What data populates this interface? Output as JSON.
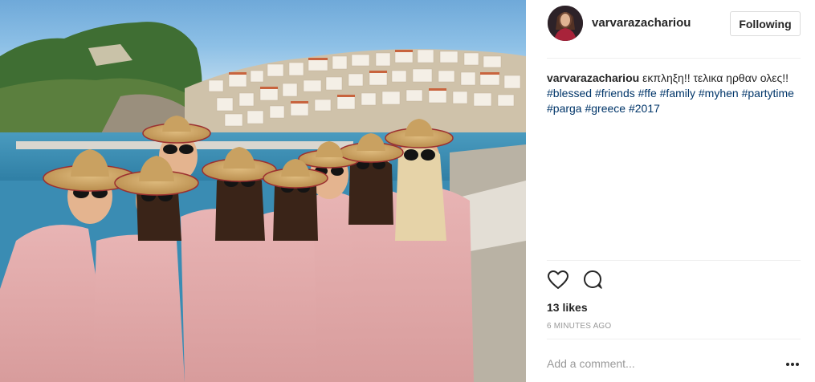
{
  "post": {
    "username": "varvarazachariou",
    "follow_label": "Following",
    "caption": {
      "username": "varvarazachariou",
      "text": "εκπληξη!! τελικα ηρθαν ολες!!",
      "hashtags": [
        "#blessed",
        "#friends",
        "#ffe",
        "#family",
        "#myhen",
        "#partytime",
        "#parga",
        "#greece",
        "#2017"
      ]
    },
    "likes_text": "13 likes",
    "timestamp": "6 MINUTES AGO",
    "comment_placeholder": "Add a comment...",
    "icons": {
      "like": "heart-icon",
      "comment": "comment-bubble-icon",
      "more": "more-options-icon"
    }
  },
  "colors": {
    "hashtag": "#003569",
    "muted": "#999999",
    "text": "#262626",
    "border": "#dbdbdb"
  }
}
